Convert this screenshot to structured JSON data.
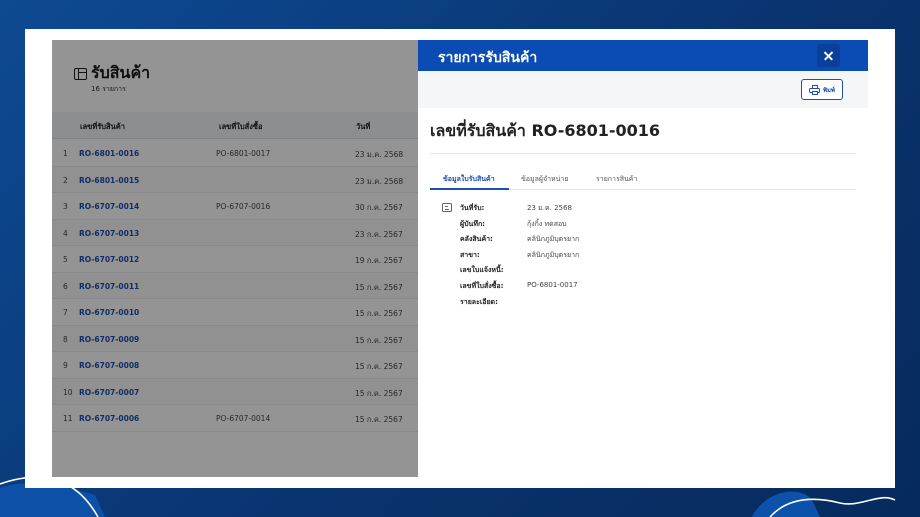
{
  "list": {
    "title": "รับสินค้า",
    "count": "16 รายการ",
    "columns": [
      "เลขที่รับสินค้า",
      "เลขที่ใบสั่งซื้อ",
      "วันที่"
    ],
    "rows": [
      {
        "no": "1",
        "ro": "RO-6801-0016",
        "po": "PO-6801-0017",
        "date": "23 ม.ค. 2568"
      },
      {
        "no": "2",
        "ro": "RO-6801-0015",
        "po": "",
        "date": "23 ม.ค. 2568"
      },
      {
        "no": "3",
        "ro": "RO-6707-0014",
        "po": "PO-6707-0016",
        "date": "30 ก.ค. 2567"
      },
      {
        "no": "4",
        "ro": "RO-6707-0013",
        "po": "",
        "date": "23 ก.ค. 2567"
      },
      {
        "no": "5",
        "ro": "RO-6707-0012",
        "po": "",
        "date": "19 ก.ค. 2567"
      },
      {
        "no": "6",
        "ro": "RO-6707-0011",
        "po": "",
        "date": "15 ก.ค. 2567"
      },
      {
        "no": "7",
        "ro": "RO-6707-0010",
        "po": "",
        "date": "15 ก.ค. 2567"
      },
      {
        "no": "8",
        "ro": "RO-6707-0009",
        "po": "",
        "date": "15 ก.ค. 2567"
      },
      {
        "no": "9",
        "ro": "RO-6707-0008",
        "po": "",
        "date": "15 ก.ค. 2567"
      },
      {
        "no": "10",
        "ro": "RO-6707-0007",
        "po": "",
        "date": "15 ก.ค. 2567"
      },
      {
        "no": "11",
        "ro": "RO-6707-0006",
        "po": "PO-6707-0014",
        "date": "15 ก.ค. 2567"
      }
    ]
  },
  "drawer": {
    "title": "รายการรับสินค้า",
    "close_icon": "close-icon",
    "print_label": "พิมพ์",
    "doc_title": "เลขที่รับสินค้า RO-6801-0016",
    "tabs": [
      {
        "label": "ข้อมูลใบรับสินค้า",
        "active": true
      },
      {
        "label": "ข้อมูลผู้จำหน่าย",
        "active": false
      },
      {
        "label": "รายการสินค้า",
        "active": false
      }
    ],
    "details": [
      {
        "label": "วันที่รับ:",
        "value": "23 ม.ค. 2568"
      },
      {
        "label": "ผู้บันทึก:",
        "value": "กุ้งกิ้ง ทดสอบ"
      },
      {
        "label": "คลังสินค้า:",
        "value": "คลินิกภูมิบุตรยาก"
      },
      {
        "label": "สาขา:",
        "value": "คลินิกภูมิบุตรยาก"
      },
      {
        "label": "เลขใบแจ้งหนี้:",
        "value": ""
      },
      {
        "label": "เลขที่ใบสั่งซื้อ:",
        "value": "PO-6801-0017"
      },
      {
        "label": "รายละเอียด:",
        "value": ""
      }
    ]
  },
  "colors": {
    "primary": "#0b4bb4",
    "link": "#1e4fae",
    "background": "#0b3a78"
  }
}
